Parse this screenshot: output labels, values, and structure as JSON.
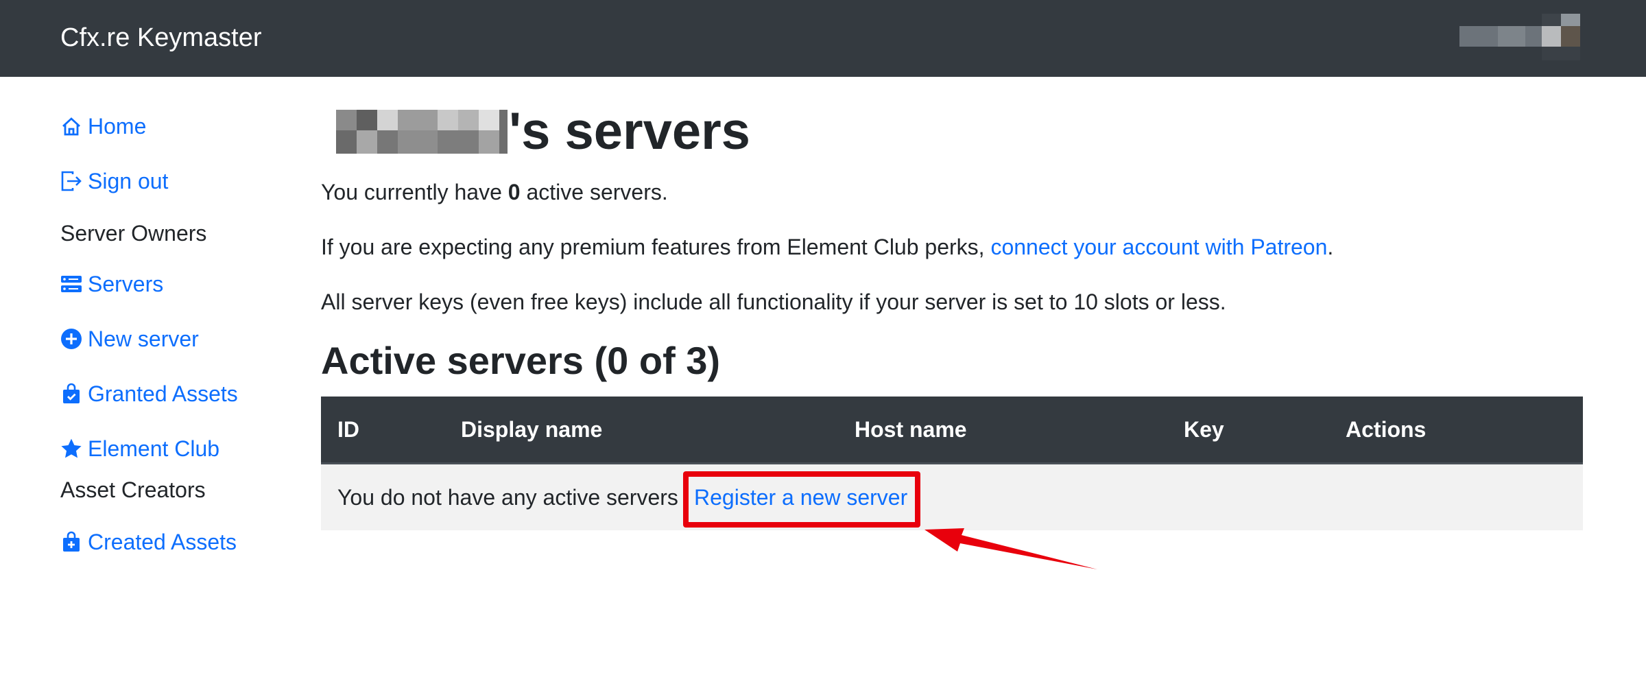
{
  "navbar": {
    "brand": "Cfx.re Keymaster"
  },
  "sidebar": {
    "items": [
      {
        "label": "Home",
        "icon": "house-icon"
      },
      {
        "label": "Sign out",
        "icon": "sign-out-icon"
      },
      {
        "heading": "Server Owners"
      },
      {
        "label": "Servers",
        "icon": "server-stack-icon"
      },
      {
        "label": "New server",
        "icon": "plus-circle-icon"
      },
      {
        "label": "Granted Assets",
        "icon": "shopping-bag-check-icon"
      },
      {
        "label": "Element Club",
        "icon": "star-icon"
      },
      {
        "heading": "Asset Creators"
      },
      {
        "label": "Created Assets",
        "icon": "shopping-bag-plus-icon"
      }
    ]
  },
  "main": {
    "title_suffix": "'s servers",
    "active_count_prefix": "You currently have ",
    "active_count": "0",
    "active_count_suffix": " active servers.",
    "patreon_prefix": "If you are expecting any premium features from Element Club perks, ",
    "patreon_link": "connect your account with Patreon",
    "patreon_suffix": ".",
    "free_keys_note": "All server keys (even free keys) include all functionality if your server is set to 10 slots or less.",
    "section_title": "Active servers (0 of 3)",
    "table": {
      "headers": [
        "ID",
        "Display name",
        "Host name",
        "Key",
        "Actions"
      ],
      "empty_text": "You do not have any active servers",
      "register_link": "Register a new server"
    }
  },
  "colors": {
    "navbar_bg": "#343a40",
    "link": "#0d6efd",
    "annotation_red": "#e8000c",
    "row_bg": "#f2f2f2"
  }
}
